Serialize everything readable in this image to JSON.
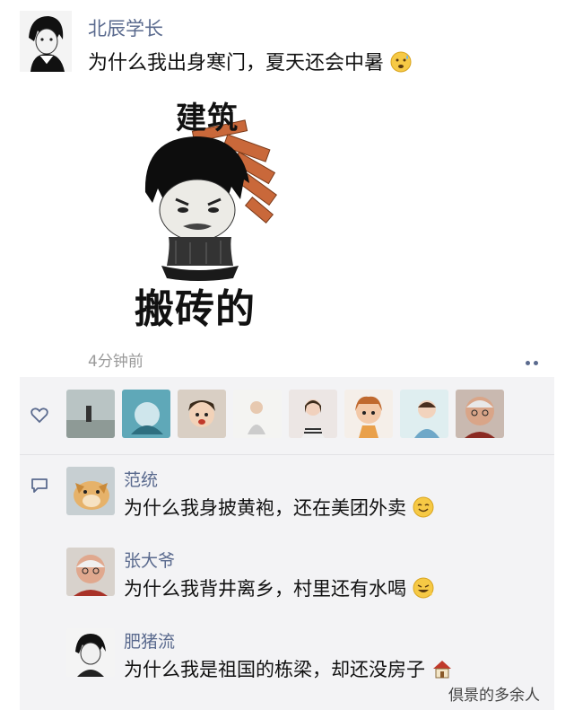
{
  "post": {
    "poster_name": "北辰学长",
    "text": "为什么我出身寒门，夏天还会中暑",
    "text_emoji_icon": "sweating-face-icon",
    "meme": {
      "top_text": "建筑",
      "bottom_text": "搬砖的"
    },
    "timestamp": "4分钟前",
    "more_icon": "more-dots-icon"
  },
  "likes": {
    "icon": "heart-outline-icon",
    "liker_count_shown": 8
  },
  "comments": {
    "icon": "comment-bubble-icon",
    "items": [
      {
        "name": "范统",
        "text": "为什么我身披黄袍，还在美团外卖",
        "emoji_icon": "smiling-face-icon"
      },
      {
        "name": "张大爷",
        "text": "为什么我背井离乡，村里还有水喝",
        "emoji_icon": "grinning-face-icon"
      },
      {
        "name": "肥猪流",
        "text": "为什么我是祖国的栋梁，却还没房子",
        "emoji_icon": "house-icon"
      }
    ]
  },
  "watermark": "倶景的多余人",
  "colors": {
    "name_blue": "#5a6a8e",
    "panel_bg": "#f3f3f5",
    "emoji_yellow": "#f6c945"
  }
}
